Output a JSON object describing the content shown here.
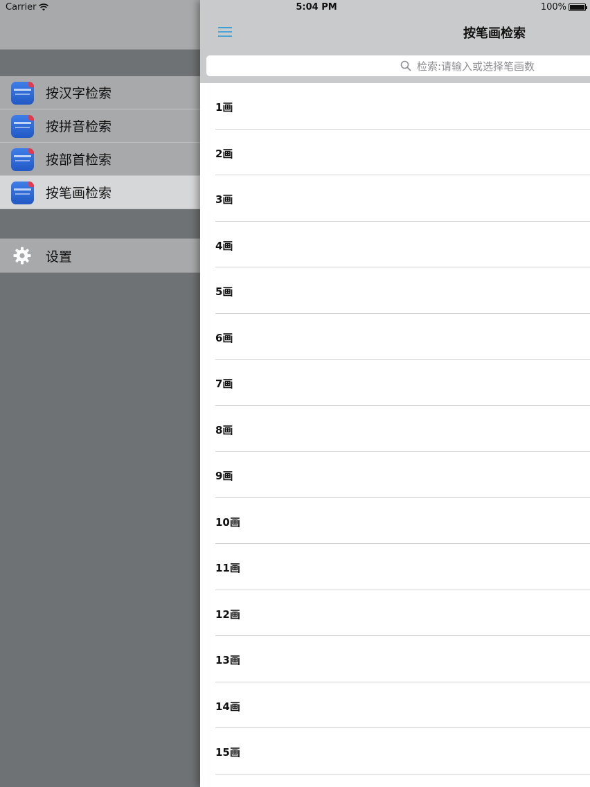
{
  "status": {
    "carrier": "Carrier",
    "time": "5:04 PM",
    "battery": "100%"
  },
  "sidebar": {
    "items": [
      {
        "label": "按汉字检索"
      },
      {
        "label": "按拼音检索"
      },
      {
        "label": "按部首检索"
      },
      {
        "label": "按笔画检索"
      }
    ],
    "selected_index": 3,
    "settings_label": "设置"
  },
  "main": {
    "title": "按笔画检索",
    "search": {
      "placeholder": "检索:请输入或选择笔画数"
    },
    "rows": [
      "1画",
      "2画",
      "3画",
      "4画",
      "5画",
      "6画",
      "7画",
      "8画",
      "9画",
      "10画",
      "11画",
      "12画",
      "13画",
      "14画",
      "15画"
    ]
  },
  "colors": {
    "accent": "#2f9bd8",
    "sidebar_bg": "#6f7274",
    "selected_bg": "#d6d7d8"
  }
}
